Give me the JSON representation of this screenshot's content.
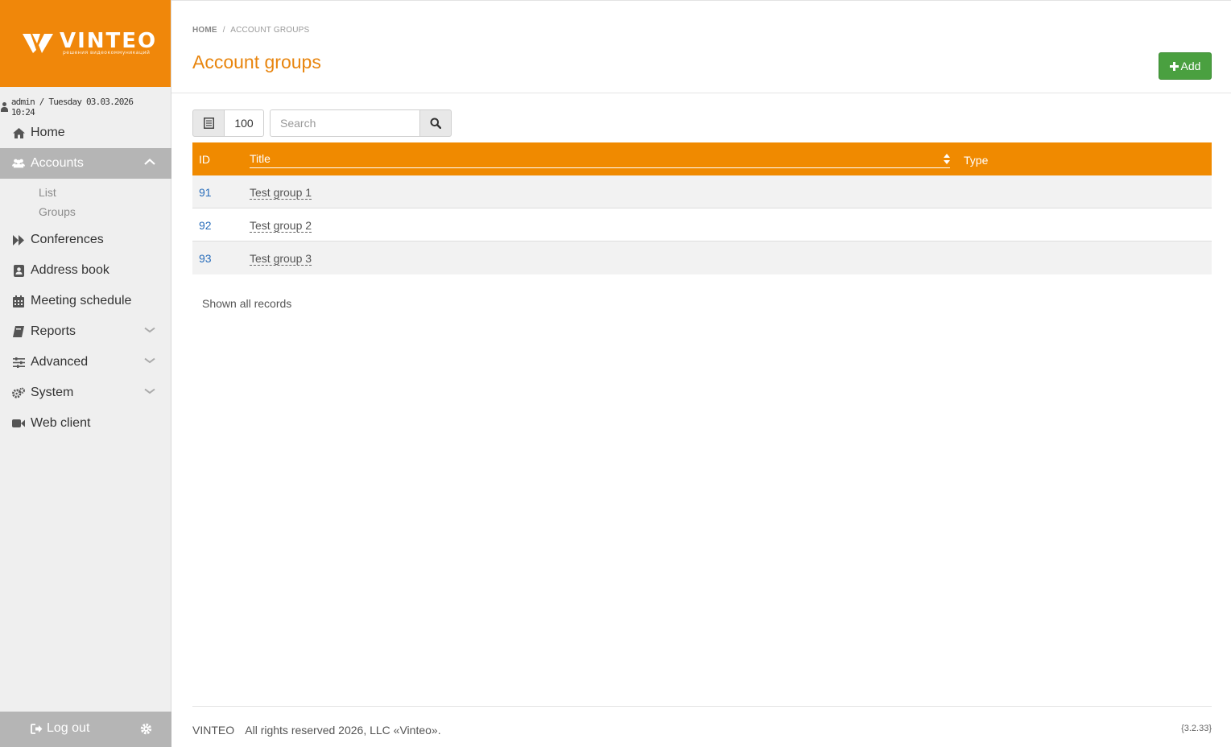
{
  "brand": {
    "name": "VINTEO",
    "tagline": "решения видеокоммуникаций",
    "color": "#f0870a"
  },
  "session": {
    "user_line": "admin / Tuesday 03.03.2026 10:24"
  },
  "sidebar": {
    "items": [
      {
        "label": "Home",
        "icon": "home-icon"
      },
      {
        "label": "Accounts",
        "icon": "users-icon",
        "active": true,
        "expanded": true,
        "children": [
          {
            "label": "List"
          },
          {
            "label": "Groups"
          }
        ]
      },
      {
        "label": "Conferences",
        "icon": "fast-forward-icon"
      },
      {
        "label": "Address book",
        "icon": "contact-book-icon"
      },
      {
        "label": "Meeting schedule",
        "icon": "calendar-icon"
      },
      {
        "label": "Reports",
        "icon": "book-icon",
        "has_submenu": true
      },
      {
        "label": "Advanced",
        "icon": "sliders-icon",
        "has_submenu": true
      },
      {
        "label": "System",
        "icon": "gears-icon",
        "has_submenu": true
      },
      {
        "label": "Web client",
        "icon": "video-camera-icon"
      }
    ],
    "logout_label": "Log out",
    "footer_color": "#b5b5b5"
  },
  "breadcrumb": {
    "home": "HOME",
    "separator": "/",
    "current": "ACCOUNT GROUPS"
  },
  "page": {
    "title": "Account groups",
    "add_label": "Add",
    "title_color": "#e8850e",
    "add_color": "#4aa040"
  },
  "toolbar": {
    "page_size": "100",
    "search_placeholder": "Search"
  },
  "table": {
    "header_color": "#f08a00",
    "columns": [
      "ID",
      "Title",
      "Type"
    ],
    "rows": [
      {
        "id": "91",
        "title": "Test group 1",
        "type": ""
      },
      {
        "id": "92",
        "title": "Test group 2",
        "type": ""
      },
      {
        "id": "93",
        "title": "Test group 3",
        "type": ""
      }
    ],
    "records_note": "Shown all records"
  },
  "footer": {
    "brand": "VINTEO",
    "copyright": "All rights reserved 2026, LLC «Vinteo».",
    "version": "{3.2.33}"
  }
}
